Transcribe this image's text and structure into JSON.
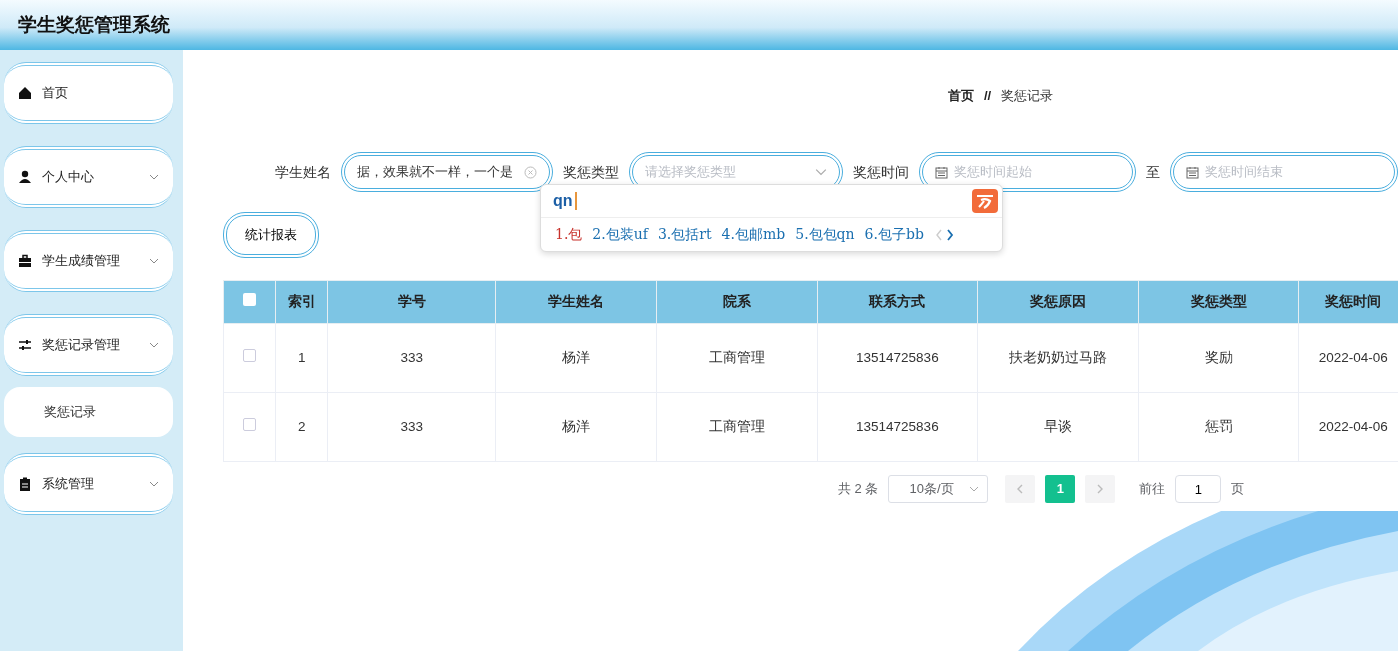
{
  "header": {
    "title": "学生奖惩管理系统"
  },
  "sidebar": {
    "items": [
      {
        "label": "首页",
        "kind": "link"
      },
      {
        "label": "个人中心",
        "kind": "submenu"
      },
      {
        "label": "学生成绩管理",
        "kind": "submenu"
      },
      {
        "label": "奖惩记录管理",
        "kind": "submenu",
        "children": [
          {
            "label": "奖惩记录"
          }
        ]
      },
      {
        "label": "系统管理",
        "kind": "submenu"
      }
    ]
  },
  "breadcrumb": {
    "items": [
      "首页",
      "奖惩记录"
    ],
    "separator": "//"
  },
  "filters": [
    {
      "kind": "text",
      "label": "学生姓名",
      "value": "据，效果就不一样，一个是"
    },
    {
      "kind": "select",
      "label": "奖惩类型",
      "placeholder": "请选择奖惩类型"
    },
    {
      "kind": "daterange",
      "label": "奖惩时间",
      "start_placeholder": "奖惩时间起始",
      "separator": "至",
      "end_placeholder": "奖惩时间结束"
    }
  ],
  "ime_popup": {
    "input": "qn",
    "candidates": [
      {
        "label": "1.包",
        "selected": true
      },
      {
        "label": "2.包装uf",
        "selected": false
      },
      {
        "label": "3.包括rt",
        "selected": false
      },
      {
        "label": "4.包邮mb",
        "selected": false
      },
      {
        "label": "5.包包qn",
        "selected": false
      },
      {
        "label": "6.包子bb",
        "selected": false
      }
    ],
    "prev_disabled": true
  },
  "buttons": [
    "统计报表"
  ],
  "table": {
    "all_checked": false,
    "columns": [
      "索引",
      "学号",
      "学生姓名",
      "院系",
      "联系方式",
      "奖惩原因",
      "奖惩类型",
      "奖惩时间"
    ],
    "rows": [
      {
        "checked": false,
        "cells": [
          "1",
          "333",
          "杨洋",
          "工商管理",
          "13514725836",
          "扶老奶奶过马路",
          "奖励",
          "2022-04-06"
        ]
      },
      {
        "checked": false,
        "cells": [
          "2",
          "333",
          "杨洋",
          "工商管理",
          "13514725836",
          "早谈",
          "惩罚",
          "2022-04-06"
        ]
      }
    ]
  },
  "pagination": {
    "total": "共 2 条",
    "page_size": "10条/页",
    "pages": [
      {
        "label": "1",
        "selected": true
      }
    ],
    "goto_label": "前往",
    "goto_value": "1",
    "goto_suffix": "页"
  }
}
